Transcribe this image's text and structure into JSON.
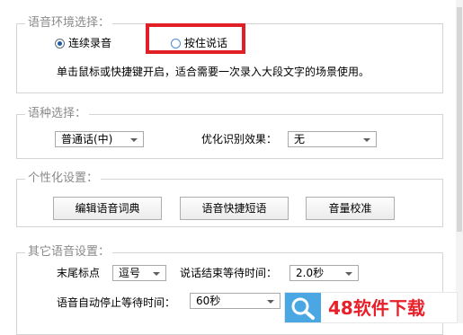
{
  "voice_env": {
    "title": "语音环境选择：",
    "options": [
      {
        "label": "连续录音",
        "selected": true
      },
      {
        "label": "按住说话",
        "selected": false
      }
    ],
    "description": "单击鼠标或快捷键开启，适合需要一次录入大段文字的场景使用。"
  },
  "language": {
    "title": "语种选择：",
    "language_value": "普通话(中)",
    "optimize_label": "优化识别效果：",
    "optimize_value": "无"
  },
  "personalize": {
    "title": "个性化设置：",
    "buttons": [
      "编辑语音词典",
      "语音快捷短语",
      "音量校准"
    ]
  },
  "other": {
    "title": "其它语音设置：",
    "end_punct_label": "末尾标点",
    "end_punct_value": "逗号",
    "wait_time_label": "说话结束等待时间：",
    "wait_time_value": "2.0秒",
    "auto_stop_label": "语音自动停止等待时间：",
    "auto_stop_value": "60秒"
  },
  "watermark": {
    "text": "48软件下载",
    "icon": "magnifier-icon"
  },
  "colors": {
    "highlight": "#e11f26",
    "radio_dot": "#1e5aa8",
    "watermark_text": "#e7202a",
    "watermark_icon_bg": "#4aa7e4"
  }
}
